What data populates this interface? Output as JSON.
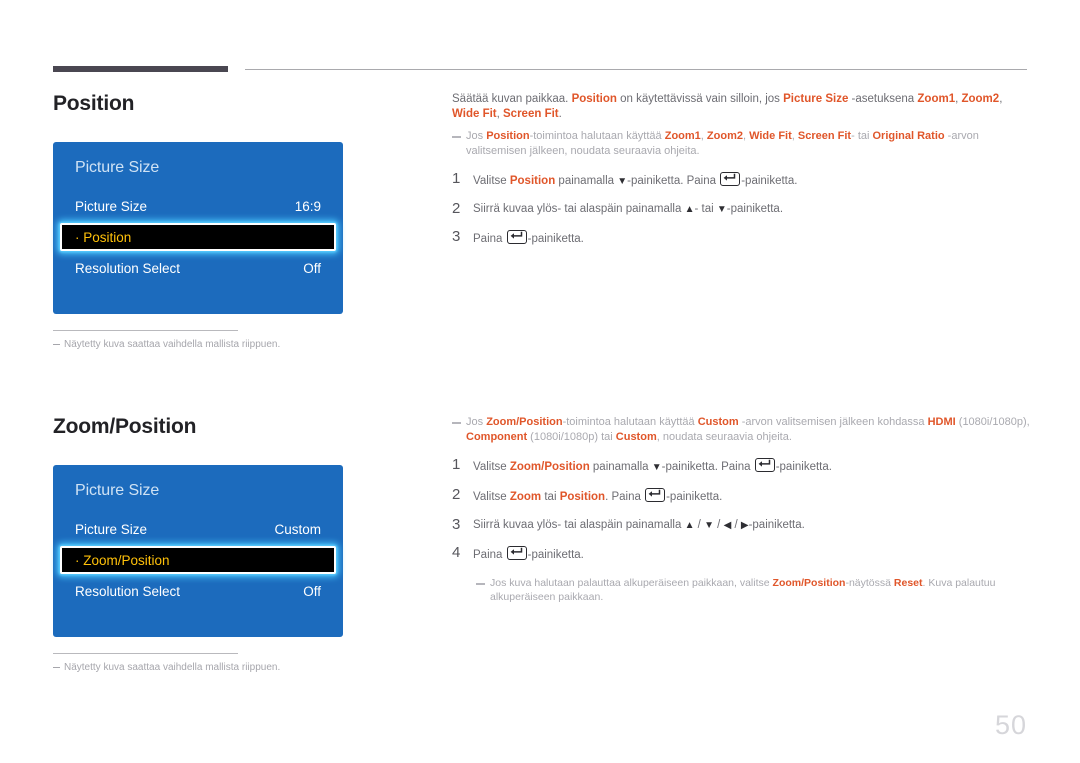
{
  "page": {
    "number": "50",
    "accent_orange": "#e0562a",
    "osd_blue": "#1c6bbd",
    "highlight_yellow": "#ffc10a",
    "glow_cyan": "#49c8ff"
  },
  "sections": [
    {
      "heading": "Position",
      "osd": {
        "title": "Picture Size",
        "rows": [
          {
            "label": "Picture Size",
            "value": "16:9",
            "selected": false
          },
          {
            "label": "· Position",
            "value": "",
            "selected": true
          },
          {
            "label": "Resolution Select",
            "value": "Off",
            "selected": false
          }
        ]
      },
      "footnote": "Näytetty kuva saattaa vaihdella mallista riippuen.",
      "intro_parts": [
        {
          "text": "Säätää kuvan paikkaa. ",
          "style": "normal"
        },
        {
          "text": "Position",
          "style": "highlight"
        },
        {
          "text": " on käytettävissä vain silloin, jos ",
          "style": "normal"
        },
        {
          "text": "Picture Size",
          "style": "highlight"
        },
        {
          "text": " -asetuksena ",
          "style": "normal"
        },
        {
          "text": "Zoom1",
          "style": "highlight"
        },
        {
          "text": ", ",
          "style": "normal"
        },
        {
          "text": "Zoom2",
          "style": "highlight"
        },
        {
          "text": ", ",
          "style": "normal"
        },
        {
          "text": "Wide Fit",
          "style": "highlight"
        },
        {
          "text": ", ",
          "style": "normal"
        },
        {
          "text": "Screen Fit",
          "style": "highlight"
        },
        {
          "text": ".",
          "style": "normal"
        }
      ],
      "note_parts": [
        {
          "text": "Jos ",
          "style": "dim"
        },
        {
          "text": "Position",
          "style": "highlight"
        },
        {
          "text": "-toimintoa halutaan käyttää ",
          "style": "dim"
        },
        {
          "text": "Zoom1",
          "style": "highlight"
        },
        {
          "text": ", ",
          "style": "dim"
        },
        {
          "text": "Zoom2",
          "style": "highlight"
        },
        {
          "text": ", ",
          "style": "dim"
        },
        {
          "text": "Wide Fit",
          "style": "highlight"
        },
        {
          "text": ", ",
          "style": "dim"
        },
        {
          "text": "Screen Fit",
          "style": "highlight"
        },
        {
          "text": "- tai ",
          "style": "dim"
        },
        {
          "text": "Original Ratio",
          "style": "highlight"
        },
        {
          "text": " -arvon valitsemisen jälkeen, noudata seuraavia ohjeita.",
          "style": "dim"
        }
      ],
      "steps": [
        {
          "num": "1",
          "parts": [
            {
              "text": "Valitse ",
              "style": "normal"
            },
            {
              "text": "Position",
              "style": "highlight"
            },
            {
              "text": " painamalla ",
              "style": "normal"
            },
            {
              "text": "▼",
              "style": "arrow"
            },
            {
              "text": "-painiketta. Paina ",
              "style": "normal"
            },
            {
              "text": "",
              "style": "enter-key"
            },
            {
              "text": "-painiketta.",
              "style": "normal"
            }
          ]
        },
        {
          "num": "2",
          "parts": [
            {
              "text": "Siirrä kuvaa ylös- tai alaspäin painamalla ",
              "style": "normal"
            },
            {
              "text": "▲",
              "style": "arrow"
            },
            {
              "text": "- tai ",
              "style": "normal"
            },
            {
              "text": "▼",
              "style": "arrow"
            },
            {
              "text": "-painiketta.",
              "style": "normal"
            }
          ]
        },
        {
          "num": "3",
          "parts": [
            {
              "text": "Paina ",
              "style": "normal"
            },
            {
              "text": "",
              "style": "enter-key"
            },
            {
              "text": "-painiketta.",
              "style": "normal"
            }
          ]
        }
      ],
      "subnote_parts": []
    },
    {
      "heading": "Zoom/Position",
      "osd": {
        "title": "Picture Size",
        "rows": [
          {
            "label": "Picture Size",
            "value": "Custom",
            "selected": false
          },
          {
            "label": "· Zoom/Position",
            "value": "",
            "selected": true
          },
          {
            "label": "Resolution Select",
            "value": "Off",
            "selected": false
          }
        ]
      },
      "footnote": "Näytetty kuva saattaa vaihdella mallista riippuen.",
      "intro_parts": [],
      "note_parts": [
        {
          "text": "Jos ",
          "style": "dim"
        },
        {
          "text": "Zoom/Position",
          "style": "highlight"
        },
        {
          "text": "-toimintoa halutaan käyttää ",
          "style": "dim"
        },
        {
          "text": "Custom",
          "style": "highlight"
        },
        {
          "text": " -arvon valitsemisen jälkeen kohdassa ",
          "style": "dim"
        },
        {
          "text": "HDMI",
          "style": "highlight"
        },
        {
          "text": " (1080i/1080p), ",
          "style": "dim"
        },
        {
          "text": "Component",
          "style": "highlight"
        },
        {
          "text": " (1080i/1080p) tai ",
          "style": "dim"
        },
        {
          "text": "Custom",
          "style": "highlight"
        },
        {
          "text": ", noudata seuraavia ohjeita.",
          "style": "dim"
        }
      ],
      "steps": [
        {
          "num": "1",
          "parts": [
            {
              "text": "Valitse ",
              "style": "normal"
            },
            {
              "text": "Zoom/Position",
              "style": "highlight"
            },
            {
              "text": " painamalla ",
              "style": "normal"
            },
            {
              "text": "▼",
              "style": "arrow"
            },
            {
              "text": "-painiketta. Paina ",
              "style": "normal"
            },
            {
              "text": "",
              "style": "enter-key"
            },
            {
              "text": "-painiketta.",
              "style": "normal"
            }
          ]
        },
        {
          "num": "2",
          "parts": [
            {
              "text": "Valitse ",
              "style": "normal"
            },
            {
              "text": "Zoom",
              "style": "highlight"
            },
            {
              "text": " tai ",
              "style": "normal"
            },
            {
              "text": "Position",
              "style": "highlight"
            },
            {
              "text": ". Paina ",
              "style": "normal"
            },
            {
              "text": "",
              "style": "enter-key"
            },
            {
              "text": "-painiketta.",
              "style": "normal"
            }
          ]
        },
        {
          "num": "3",
          "parts": [
            {
              "text": "Siirrä kuvaa ylös- tai alaspäin painamalla ",
              "style": "normal"
            },
            {
              "text": "▲",
              "style": "arrow"
            },
            {
              "text": " / ",
              "style": "normal"
            },
            {
              "text": "▼",
              "style": "arrow"
            },
            {
              "text": " / ",
              "style": "normal"
            },
            {
              "text": "◀",
              "style": "arrow"
            },
            {
              "text": " / ",
              "style": "normal"
            },
            {
              "text": "▶",
              "style": "arrow"
            },
            {
              "text": "-painiketta.",
              "style": "normal"
            }
          ]
        },
        {
          "num": "4",
          "parts": [
            {
              "text": "Paina ",
              "style": "normal"
            },
            {
              "text": "",
              "style": "enter-key"
            },
            {
              "text": "-painiketta.",
              "style": "normal"
            }
          ]
        }
      ],
      "subnote_parts": [
        {
          "text": "Jos kuva halutaan palauttaa alkuperäiseen paikkaan, valitse ",
          "style": "dim"
        },
        {
          "text": "Zoom/Position",
          "style": "highlight"
        },
        {
          "text": "-näytössä ",
          "style": "dim"
        },
        {
          "text": "Reset",
          "style": "highlight"
        },
        {
          "text": ". Kuva palautuu alkuperäiseen paikkaan.",
          "style": "dim"
        }
      ]
    }
  ]
}
